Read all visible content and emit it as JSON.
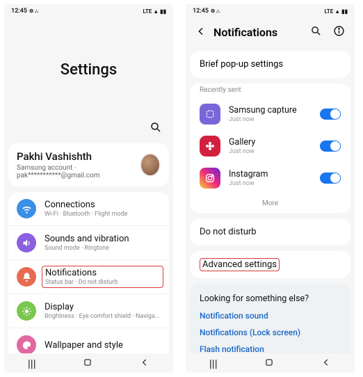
{
  "status": {
    "time": "12:45",
    "right": "LTE ▲ ▮▮"
  },
  "left": {
    "heroTitle": "Settings",
    "accountName": "Pakhi Vashishth",
    "accountSub": "Samsung account · pak***********@gmail.com",
    "rows": [
      {
        "title": "Connections",
        "sub": "Wi-Fi · Bluetooth · Flight mode",
        "color": "#3a8fe6",
        "icon": "wifi"
      },
      {
        "title": "Sounds and vibration",
        "sub": "Sound mode · Ringtone",
        "color": "#8a5fe0",
        "icon": "sound"
      },
      {
        "title": "Notifications",
        "sub": "Status bar · Do not disturb",
        "color": "#e86a4f",
        "icon": "bell",
        "highlight": true
      },
      {
        "title": "Display",
        "sub": "Brightness · Eye comfort shield · Navigation bar",
        "color": "#7ac74f",
        "icon": "sun"
      },
      {
        "title": "Wallpaper and style",
        "sub": "",
        "color": "#e06aa0",
        "icon": "palette"
      }
    ]
  },
  "right": {
    "title": "Notifications",
    "brief": "Brief pop-up settings",
    "recentLabel": "Recently sent",
    "apps": [
      {
        "title": "Samsung capture",
        "sub": "Just now",
        "bg": "#7a66d8",
        "toggle": true,
        "icon": "capture"
      },
      {
        "title": "Gallery",
        "sub": "Just now",
        "bg": "#d4203f",
        "toggle": true,
        "icon": "flower"
      },
      {
        "title": "Instagram",
        "sub": "Just now",
        "bg": "linear-gradient(45deg,#f9ce34,#ee2a7b,#6228d7)",
        "toggle": true,
        "icon": "insta"
      }
    ],
    "more": "More",
    "dnd": "Do not disturb",
    "advanced": "Advanced settings",
    "lookingTitle": "Looking for something else?",
    "links": [
      "Notification sound",
      "Notifications (Lock screen)",
      "Flash notification"
    ]
  }
}
